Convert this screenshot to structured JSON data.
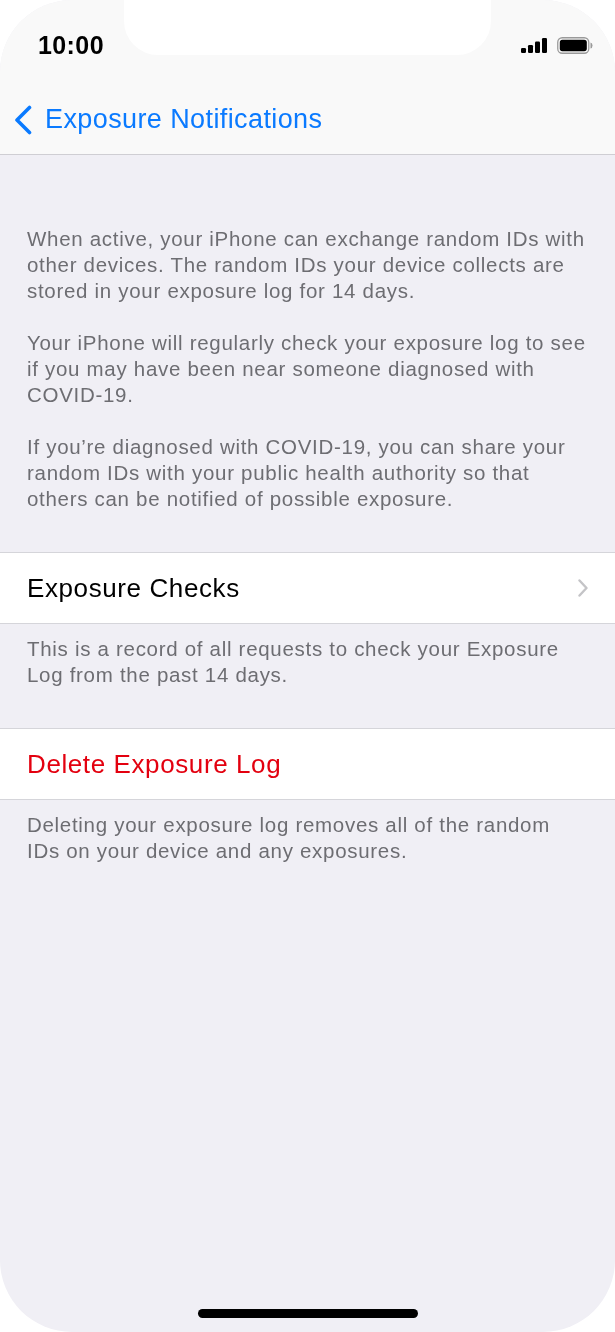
{
  "status_bar": {
    "time": "10:00"
  },
  "nav_bar": {
    "back_label": "Exposure Notifications"
  },
  "intro": {
    "paragraphs": [
      "When active, your iPhone can exchange random IDs with other devices. The random IDs your device collects are stored in your exposure log for 14 days.",
      "Your iPhone will regularly check your exposure log to see if you may have been near someone diagnosed with COVID-19.",
      "If you’re diagnosed with COVID-19, you can share your random IDs with your public health authority so that others can be notified of possible exposure."
    ]
  },
  "sections": [
    {
      "rows": [
        {
          "kind": "navigation",
          "label": "Exposure Checks"
        }
      ],
      "footer": "This is a record of all requests to check your Exposure Log from the past 14 days."
    },
    {
      "rows": [
        {
          "kind": "destructive",
          "label": "Delete Exposure Log"
        }
      ],
      "footer": "Deleting your exposure log removes all of the random IDs on your device and any exposures."
    }
  ]
}
